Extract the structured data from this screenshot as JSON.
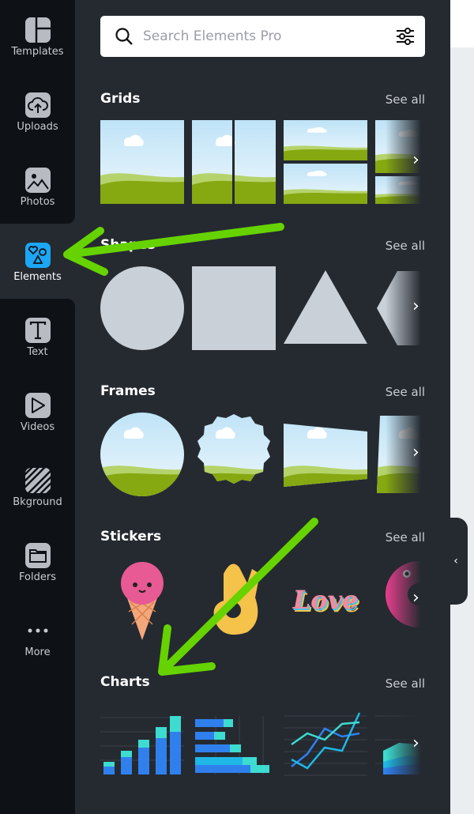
{
  "sidebar": {
    "items": [
      {
        "label": "Templates",
        "icon": "templates-icon"
      },
      {
        "label": "Uploads",
        "icon": "upload-cloud-icon"
      },
      {
        "label": "Photos",
        "icon": "photo-icon"
      },
      {
        "label": "Elements",
        "icon": "elements-shapes-icon",
        "active": true
      },
      {
        "label": "Text",
        "icon": "text-t-icon"
      },
      {
        "label": "Videos",
        "icon": "play-icon"
      },
      {
        "label": "Bkground",
        "icon": "background-stripes-icon"
      },
      {
        "label": "Folders",
        "icon": "folder-icon"
      },
      {
        "label": "More",
        "icon": "more-dots-icon"
      }
    ]
  },
  "search": {
    "placeholder": "Search Elements Pro"
  },
  "sections": [
    {
      "title": "Grids",
      "see_all": "See all"
    },
    {
      "title": "Shapes",
      "see_all": "See all"
    },
    {
      "title": "Frames",
      "see_all": "See all"
    },
    {
      "title": "Stickers",
      "see_all": "See all"
    },
    {
      "title": "Charts",
      "see_all": "See all"
    }
  ],
  "stickers": {
    "love_text": "Love"
  },
  "colors": {
    "accent": "#1ba7f5",
    "annotation_arrow": "#66d300",
    "panel": "#252a31",
    "sidebar": "#0e1217"
  }
}
